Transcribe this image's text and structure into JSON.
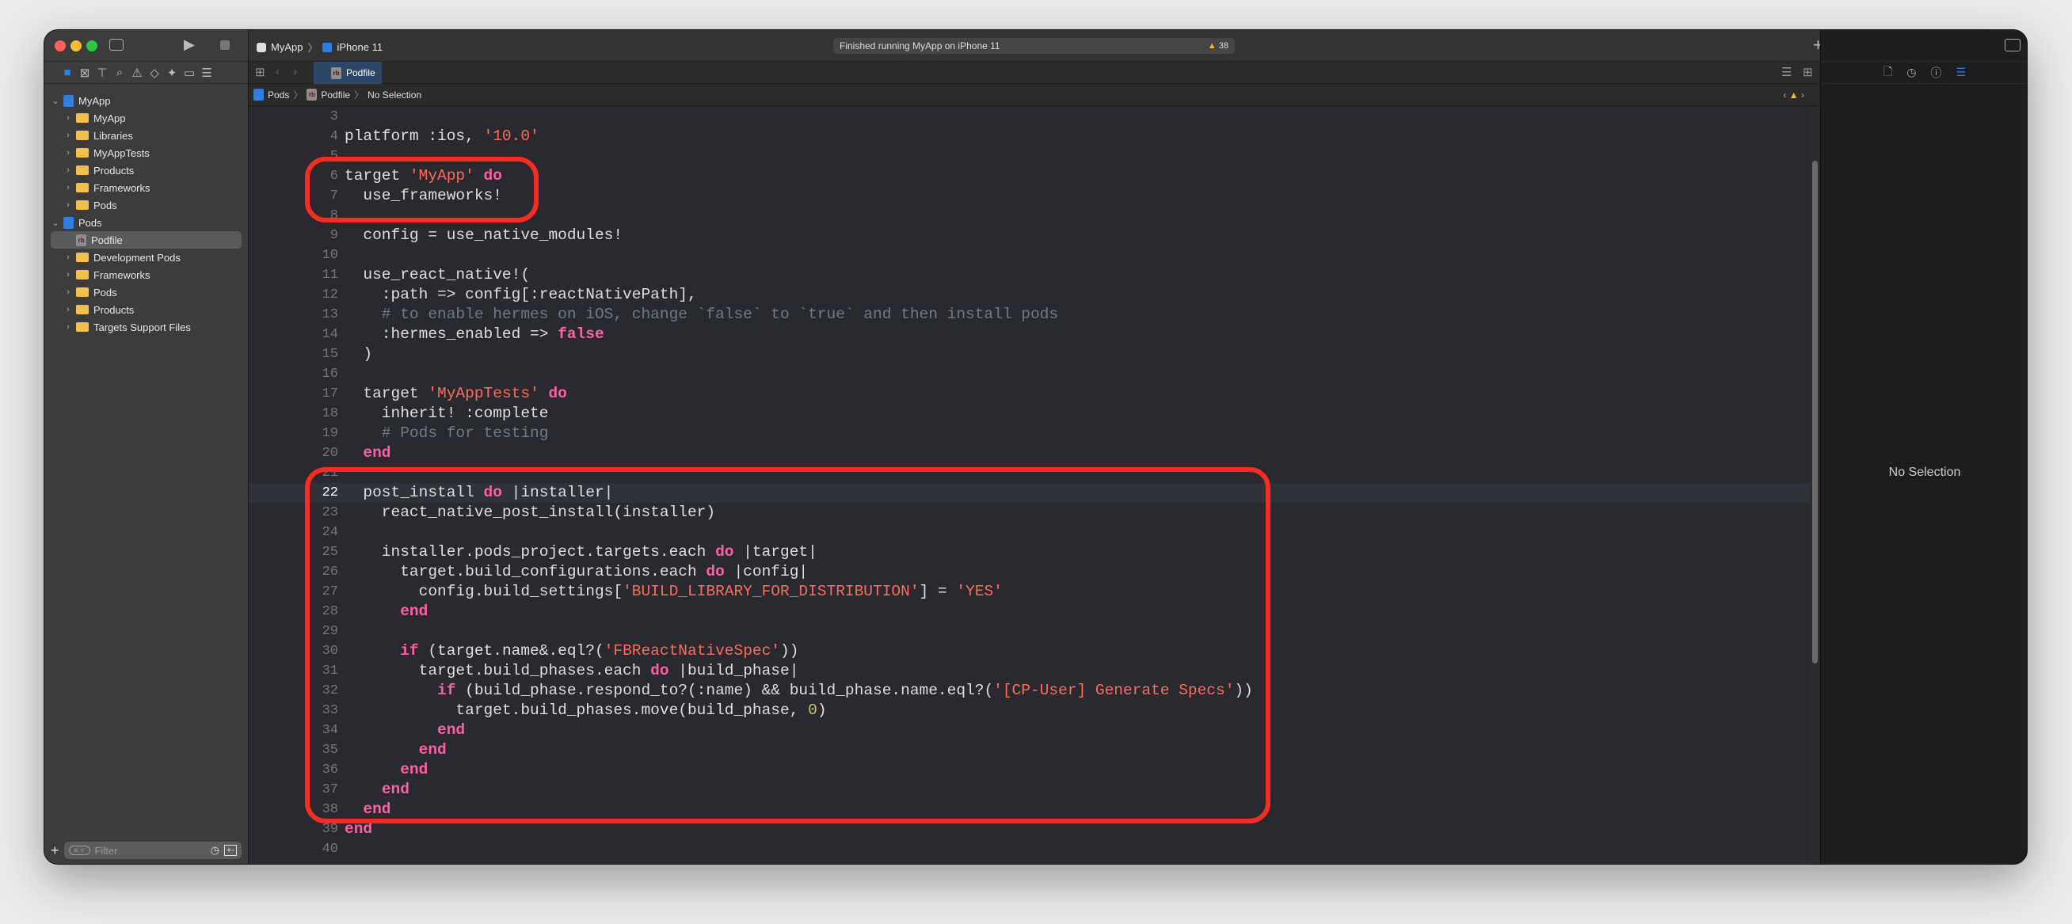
{
  "window": {
    "scheme": "MyApp",
    "device": "iPhone 11",
    "status": "Finished running MyApp on iPhone 11",
    "warning_count": "38"
  },
  "tab": {
    "label": "Podfile",
    "file_badge": "rb"
  },
  "breadcrumb": [
    "Pods",
    "Podfile",
    "No Selection"
  ],
  "sidebar": {
    "items": [
      {
        "label": "MyApp",
        "type": "project",
        "level": 0,
        "expanded": true
      },
      {
        "label": "MyApp",
        "type": "folder",
        "level": 1
      },
      {
        "label": "Libraries",
        "type": "folder",
        "level": 1
      },
      {
        "label": "MyAppTests",
        "type": "folder",
        "level": 1
      },
      {
        "label": "Products",
        "type": "folder",
        "level": 1
      },
      {
        "label": "Frameworks",
        "type": "folder",
        "level": 1
      },
      {
        "label": "Pods",
        "type": "folder",
        "level": 1
      },
      {
        "label": "Pods",
        "type": "project",
        "level": 0,
        "expanded": true
      },
      {
        "label": "Podfile",
        "type": "file",
        "level": 1,
        "selected": true
      },
      {
        "label": "Development Pods",
        "type": "folder",
        "level": 1
      },
      {
        "label": "Frameworks",
        "type": "folder",
        "level": 1
      },
      {
        "label": "Pods",
        "type": "folder",
        "level": 1
      },
      {
        "label": "Products",
        "type": "folder",
        "level": 1
      },
      {
        "label": "Targets Support Files",
        "type": "folder",
        "level": 1
      }
    ],
    "filter_placeholder": "Filter"
  },
  "inspector": {
    "empty_label": "No Selection"
  },
  "editor": {
    "current_line": 22,
    "lines": [
      {
        "n": 3,
        "t": []
      },
      {
        "n": 4,
        "t": [
          [
            "platform :ios, ",
            ""
          ],
          [
            "'10.0'",
            "str"
          ]
        ]
      },
      {
        "n": 5,
        "t": []
      },
      {
        "n": 6,
        "t": [
          [
            "target ",
            ""
          ],
          [
            "'MyApp'",
            "str"
          ],
          [
            " ",
            ""
          ],
          [
            "do",
            "kw"
          ]
        ]
      },
      {
        "n": 7,
        "t": [
          [
            "  use_frameworks!",
            ""
          ]
        ]
      },
      {
        "n": 8,
        "t": []
      },
      {
        "n": 9,
        "t": [
          [
            "  config = use_native_modules!",
            ""
          ]
        ]
      },
      {
        "n": 10,
        "t": []
      },
      {
        "n": 11,
        "t": [
          [
            "  use_react_native!(",
            ""
          ]
        ]
      },
      {
        "n": 12,
        "t": [
          [
            "    :path => config[:reactNativePath],",
            ""
          ]
        ]
      },
      {
        "n": 13,
        "t": [
          [
            "    # to enable hermes on iOS, change `false` to `true` and then install pods",
            "cm"
          ]
        ]
      },
      {
        "n": 14,
        "t": [
          [
            "    :hermes_enabled => ",
            ""
          ],
          [
            "false",
            "kw"
          ]
        ]
      },
      {
        "n": 15,
        "t": [
          [
            "  )",
            ""
          ]
        ]
      },
      {
        "n": 16,
        "t": []
      },
      {
        "n": 17,
        "t": [
          [
            "  target ",
            ""
          ],
          [
            "'MyAppTests'",
            "str"
          ],
          [
            " ",
            ""
          ],
          [
            "do",
            "kw"
          ]
        ]
      },
      {
        "n": 18,
        "t": [
          [
            "    inherit! :complete",
            ""
          ]
        ]
      },
      {
        "n": 19,
        "t": [
          [
            "    # Pods for testing",
            "cm"
          ]
        ]
      },
      {
        "n": 20,
        "t": [
          [
            "  ",
            ""
          ],
          [
            "end",
            "kw"
          ]
        ]
      },
      {
        "n": 21,
        "t": []
      },
      {
        "n": 22,
        "t": [
          [
            "  post_install ",
            ""
          ],
          [
            "do",
            "kw"
          ],
          [
            " |installer|",
            ""
          ]
        ]
      },
      {
        "n": 23,
        "t": [
          [
            "    react_native_post_install(installer)",
            ""
          ]
        ]
      },
      {
        "n": 24,
        "t": []
      },
      {
        "n": 25,
        "t": [
          [
            "    installer.pods_project.targets.each ",
            ""
          ],
          [
            "do",
            "kw"
          ],
          [
            " |target|",
            ""
          ]
        ]
      },
      {
        "n": 26,
        "t": [
          [
            "      target.build_configurations.each ",
            ""
          ],
          [
            "do",
            "kw"
          ],
          [
            " |config|",
            ""
          ]
        ]
      },
      {
        "n": 27,
        "t": [
          [
            "        config.build_settings[",
            ""
          ],
          [
            "'BUILD_LIBRARY_FOR_DISTRIBUTION'",
            "str"
          ],
          [
            "] = ",
            ""
          ],
          [
            "'YES'",
            "str"
          ]
        ]
      },
      {
        "n": 28,
        "t": [
          [
            "      ",
            ""
          ],
          [
            "end",
            "kw"
          ]
        ]
      },
      {
        "n": 29,
        "t": []
      },
      {
        "n": 30,
        "t": [
          [
            "      ",
            ""
          ],
          [
            "if",
            "kw"
          ],
          [
            " (target.name&.eql?(",
            ""
          ],
          [
            "'FBReactNativeSpec'",
            "str"
          ],
          [
            "))",
            ""
          ]
        ]
      },
      {
        "n": 31,
        "t": [
          [
            "        target.build_phases.each ",
            ""
          ],
          [
            "do",
            "kw"
          ],
          [
            " |build_phase|",
            ""
          ]
        ]
      },
      {
        "n": 32,
        "t": [
          [
            "          ",
            ""
          ],
          [
            "if",
            "kw"
          ],
          [
            " (build_phase.respond_to?(:name) && build_phase.name.eql?(",
            ""
          ],
          [
            "'[CP-User] Generate Specs'",
            "str"
          ],
          [
            "))",
            ""
          ]
        ]
      },
      {
        "n": 33,
        "t": [
          [
            "            target.build_phases.move(build_phase, ",
            ""
          ],
          [
            "0",
            "num"
          ],
          [
            ")",
            ""
          ]
        ]
      },
      {
        "n": 34,
        "t": [
          [
            "          ",
            ""
          ],
          [
            "end",
            "kw"
          ]
        ]
      },
      {
        "n": 35,
        "t": [
          [
            "        ",
            ""
          ],
          [
            "end",
            "kw"
          ]
        ]
      },
      {
        "n": 36,
        "t": [
          [
            "      ",
            ""
          ],
          [
            "end",
            "kw"
          ]
        ]
      },
      {
        "n": 37,
        "t": [
          [
            "    ",
            ""
          ],
          [
            "end",
            "kw"
          ]
        ]
      },
      {
        "n": 38,
        "t": [
          [
            "  ",
            ""
          ],
          [
            "end",
            "kw"
          ]
        ]
      },
      {
        "n": 39,
        "t": [
          [
            "end",
            "kw"
          ]
        ]
      },
      {
        "n": 40,
        "t": []
      }
    ]
  },
  "colors": {
    "keyword": "#fc5fa3",
    "string": "#fc6a5d",
    "comment": "#6c7986",
    "number": "#d0bf69",
    "annotation": "#ff2a1f",
    "accent": "#2f7ee0"
  }
}
